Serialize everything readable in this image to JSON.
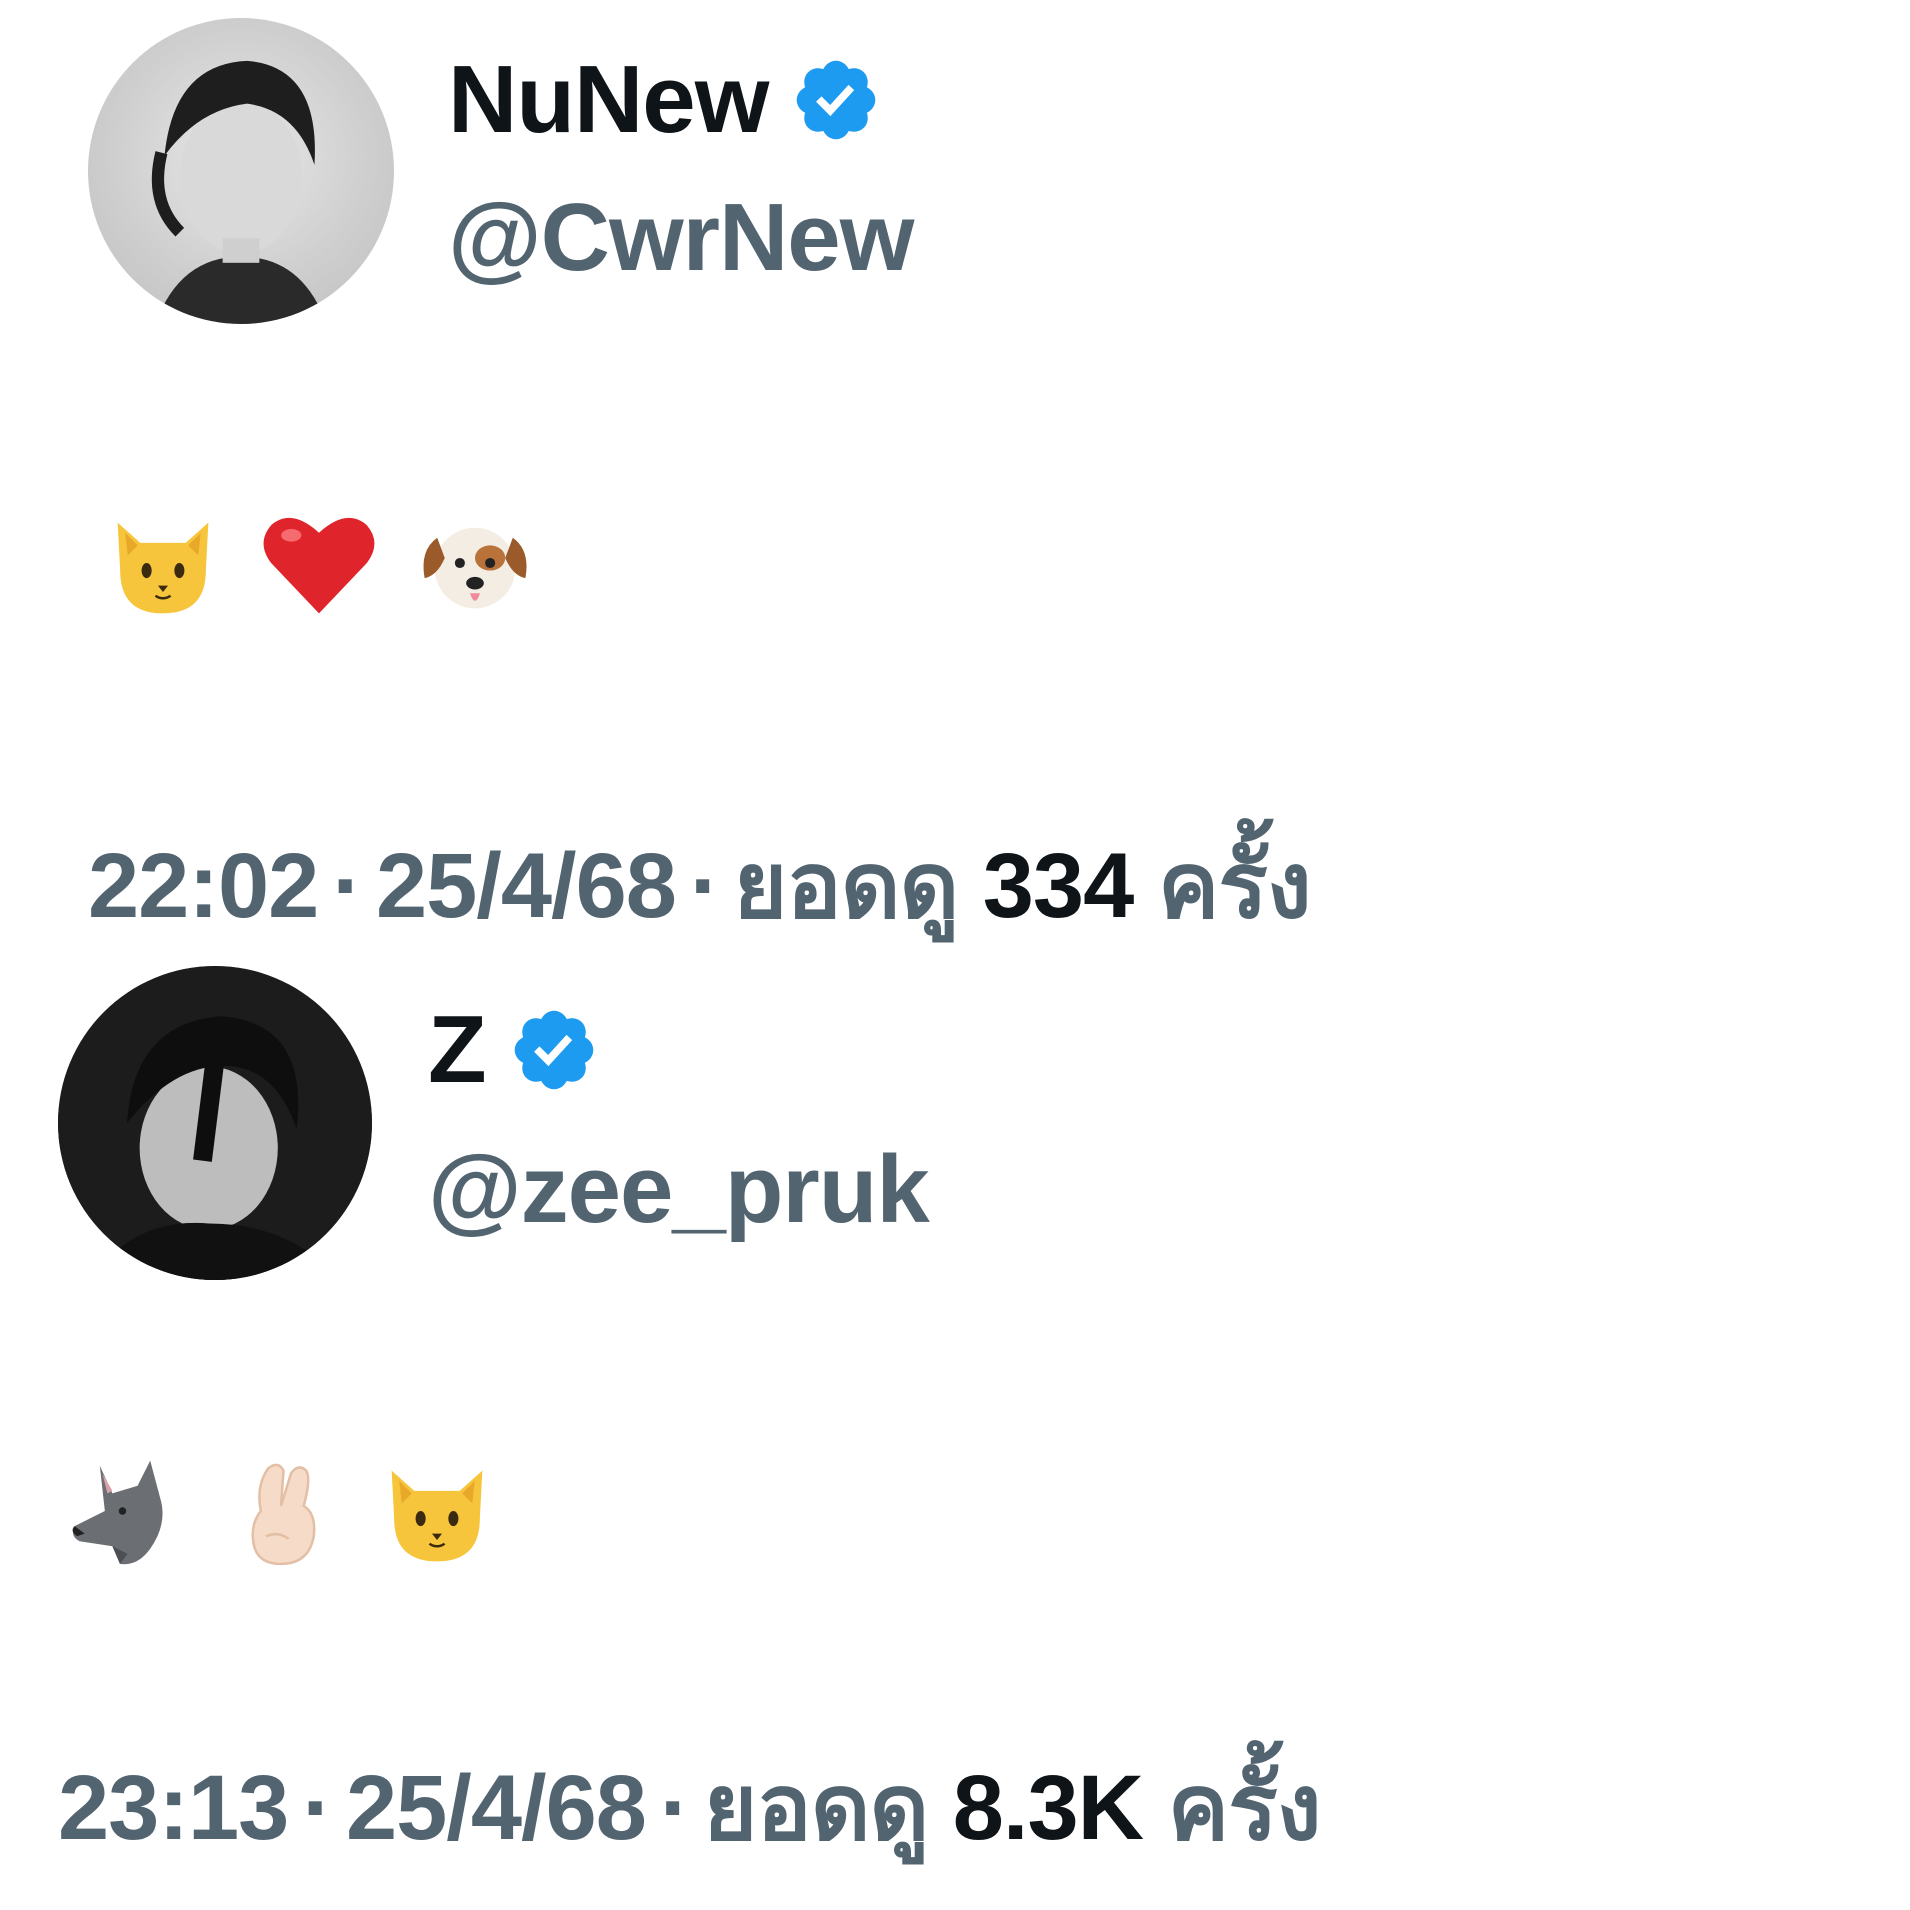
{
  "colors": {
    "name_text": "#0f1419",
    "secondary_text": "#536471",
    "verified_blue": "#1d9bf0",
    "background": "#ffffff"
  },
  "tweets": [
    {
      "display_name": "NuNew",
      "handle": "@CwrNew",
      "verified": true,
      "avatar": "grayscale-portrait-photo",
      "emojis": [
        "cat-face-emoji",
        "red-heart-emoji",
        "dog-face-emoji"
      ],
      "time": "22:02",
      "separator": "·",
      "date": "25/4/68",
      "views_label": "ยอดดู",
      "views_count": "334",
      "views_suffix": "ครั้ง"
    },
    {
      "display_name": "Z",
      "handle": "@zee_pruk",
      "verified": true,
      "avatar": "grayscale-portrait-photo",
      "emojis": [
        "wolf-face-emoji",
        "hand-with-index-finger-and-thumb-crossed-emoji",
        "cat-face-emoji"
      ],
      "time": "23:13",
      "separator": "·",
      "date": "25/4/68",
      "views_label": "ยอดดู",
      "views_count": "8.3K",
      "views_suffix": "ครั้ง"
    }
  ]
}
